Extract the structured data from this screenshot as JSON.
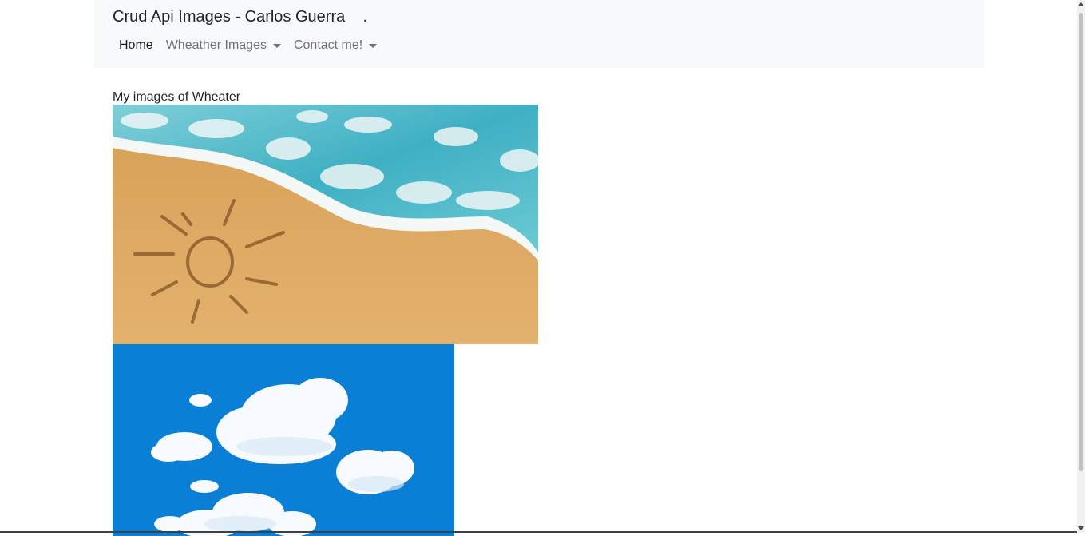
{
  "navbar": {
    "brand": "Crud Api Images - Carlos Guerra    .",
    "items": [
      {
        "label": "Home",
        "active": true,
        "dropdown": false
      },
      {
        "label": "Wheather Images",
        "active": false,
        "dropdown": true
      },
      {
        "label": "Contact me!",
        "active": false,
        "dropdown": true
      }
    ]
  },
  "main": {
    "heading": "My images of Wheater",
    "images": [
      {
        "name": "beach-sun-image"
      },
      {
        "name": "sky-clouds-image"
      }
    ]
  },
  "colors": {
    "navbar_bg": "#f8f9fa",
    "sky": "#0a7fd6",
    "sand": "#dca85e",
    "sea": "#4cb8c9"
  }
}
